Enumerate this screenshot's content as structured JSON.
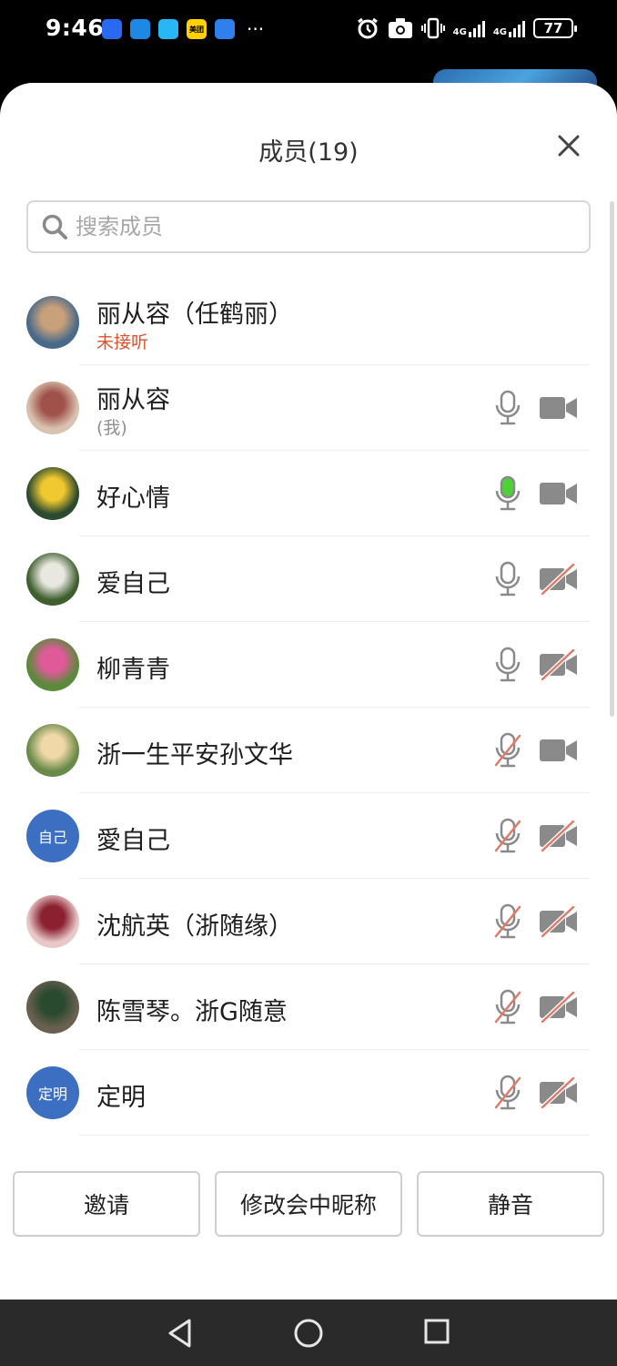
{
  "status_bar": {
    "time": "9:46",
    "network_1": "4G",
    "network_2": "4G",
    "battery": "77",
    "more": "···",
    "app_icons": [
      {
        "icon": "feishu-app-icon",
        "color": "#2a6af0",
        "label": ""
      },
      {
        "icon": "chat-app-icon",
        "color": "#1e88e5",
        "label": ""
      },
      {
        "icon": "messages-app-icon",
        "color": "#29b6f6",
        "label": ""
      },
      {
        "icon": "meituan-app-icon",
        "color": "#ffd100",
        "label": "美团"
      },
      {
        "icon": "browser-app-icon",
        "color": "#2f80ed",
        "label": ""
      }
    ]
  },
  "panel": {
    "title": "成员(19)",
    "search_placeholder": "搜索成员"
  },
  "members": [
    {
      "name": "丽从容（任鹤丽）",
      "sub": "未接听",
      "sub_style": "red",
      "avatar_type": "photo",
      "avatar_colors": [
        "#4a6a8a",
        "#c8a07a"
      ],
      "mic": "none",
      "cam": "none"
    },
    {
      "name": "丽从容",
      "sub": "(我)",
      "sub_style": "gray",
      "avatar_type": "photo",
      "avatar_colors": [
        "#d9c2b0",
        "#a0524a"
      ],
      "mic": "on",
      "cam": "on"
    },
    {
      "name": "好心情",
      "sub": "",
      "avatar_type": "photo",
      "avatar_colors": [
        "#2c4a2e",
        "#f0c830"
      ],
      "mic": "speaking",
      "cam": "on"
    },
    {
      "name": "爱自己",
      "sub": "",
      "avatar_type": "photo",
      "avatar_colors": [
        "#3f5f2f",
        "#e8e8e0"
      ],
      "mic": "on",
      "cam": "off"
    },
    {
      "name": "柳青青",
      "sub": "",
      "avatar_type": "photo",
      "avatar_colors": [
        "#5a8a3a",
        "#e05a9a"
      ],
      "mic": "on",
      "cam": "off"
    },
    {
      "name": "浙一生平安孙文华",
      "sub": "",
      "avatar_type": "photo",
      "avatar_colors": [
        "#6a8a4a",
        "#f0d8a8"
      ],
      "mic": "off",
      "cam": "on"
    },
    {
      "name": "愛自己",
      "sub": "",
      "avatar_type": "initials",
      "initials": "自己",
      "avatar_colors": [
        "#3c6ec1",
        "#3c6ec1"
      ],
      "mic": "off",
      "cam": "off"
    },
    {
      "name": "沈航英（浙随缘）",
      "sub": "",
      "avatar_type": "photo",
      "avatar_colors": [
        "#e8c8c8",
        "#8a2030"
      ],
      "mic": "off",
      "cam": "off"
    },
    {
      "name": "陈雪琴。浙G随意",
      "sub": "",
      "avatar_type": "photo",
      "avatar_colors": [
        "#6a6050",
        "#2a4a30"
      ],
      "mic": "off",
      "cam": "off"
    },
    {
      "name": "定明",
      "sub": "",
      "avatar_type": "initials",
      "initials": "定明",
      "avatar_colors": [
        "#3c6ec1",
        "#3c6ec1"
      ],
      "mic": "off",
      "cam": "off"
    }
  ],
  "buttons": {
    "invite": "邀请",
    "rename": "修改会中昵称",
    "mute": "静音"
  },
  "colors": {
    "accent_blue": "#3c6ec1",
    "red_status": "#e0502a",
    "speaking_green": "#4cd137",
    "icon_gray": "#8a8a8a",
    "disabled_slash": "#e07a6a"
  }
}
